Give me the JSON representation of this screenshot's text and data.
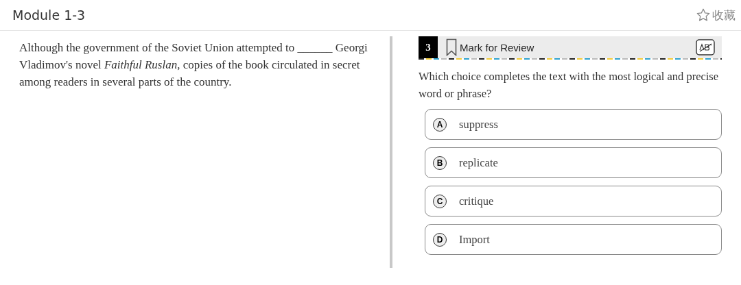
{
  "header": {
    "title": "Module 1-3",
    "favorite": {
      "label": "收藏"
    }
  },
  "passage": "Although the government of the Soviet Union attempted to ______ Georgi Vladimov's novel *Faithful Ruslan*, copies of the book circulated in secret among readers in several parts of the country.",
  "question": {
    "number": "3",
    "mark_for_review": {
      "label": "Mark for Review"
    },
    "prompt": "Which choice completes the text with the most logical and precise word or phrase?",
    "options": [
      {
        "letter": "A",
        "text": "suppress"
      },
      {
        "letter": "B",
        "text": "replicate"
      },
      {
        "letter": "C",
        "text": "critique"
      },
      {
        "letter": "D",
        "text": "Import"
      }
    ]
  }
}
